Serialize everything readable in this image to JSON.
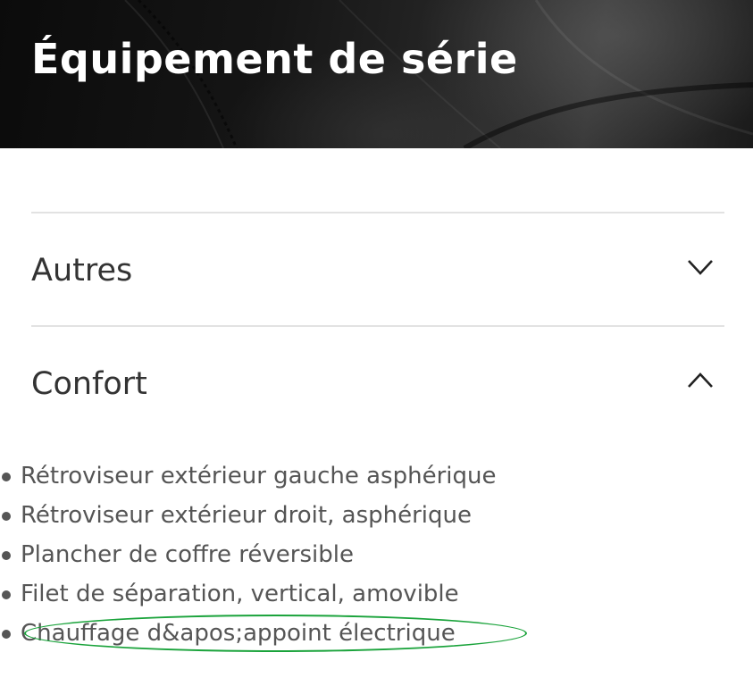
{
  "hero": {
    "title": "Équipement de série"
  },
  "accordion": {
    "sections": [
      {
        "label": "Autres",
        "expanded": false,
        "chevron": "chevron-down-icon"
      },
      {
        "label": "Confort",
        "expanded": true,
        "chevron": "chevron-up-icon"
      }
    ],
    "confort_items": [
      "Rétroviseur extérieur gauche asphérique",
      "Rétroviseur extérieur droit, asphérique",
      "Plancher de coffre réversible",
      "Filet de séparation, vertical, amovible",
      "Chauffage d&apos;appoint électrique"
    ]
  },
  "colors": {
    "highlight": "#1aa33b",
    "divider": "#e2e2e2",
    "text": "#333333"
  }
}
